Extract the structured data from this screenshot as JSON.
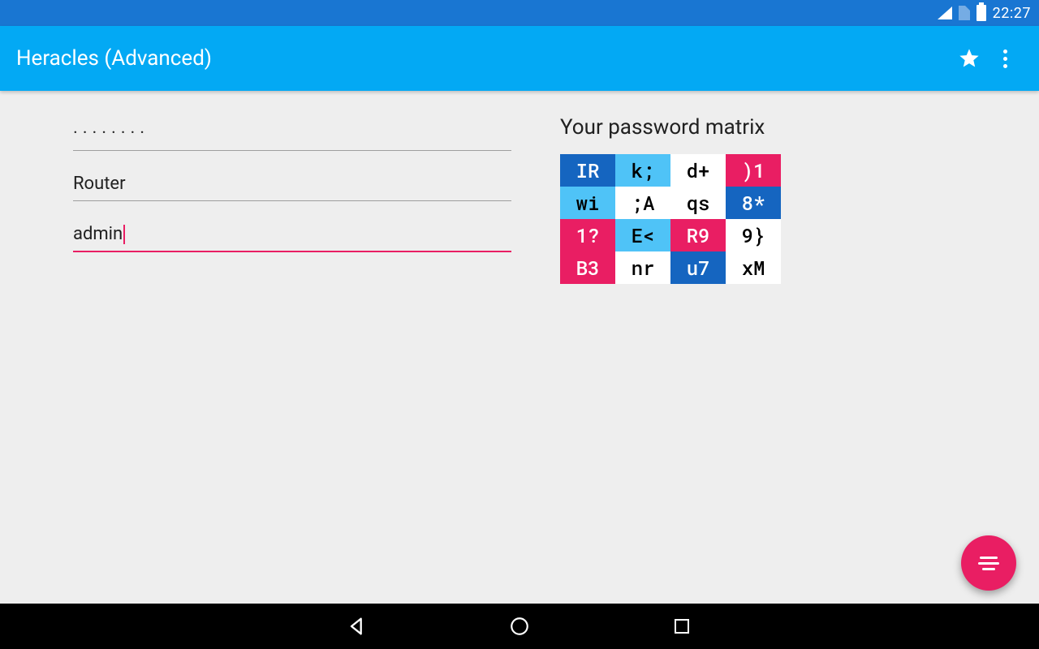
{
  "status": {
    "time": "22:27"
  },
  "appbar": {
    "title": "Heracles (Advanced)"
  },
  "form": {
    "password_mask": "········",
    "service": "Router",
    "username": "admin"
  },
  "matrix": {
    "title": "Your password matrix",
    "cells": [
      [
        {
          "v": "IR",
          "c": "darkblue"
        },
        {
          "v": "k;",
          "c": "lightblue"
        },
        {
          "v": "d+",
          "c": "white"
        },
        {
          "v": ")1",
          "c": "pink"
        }
      ],
      [
        {
          "v": "wi",
          "c": "lightblue"
        },
        {
          "v": ";A",
          "c": "white"
        },
        {
          "v": "qs",
          "c": "white"
        },
        {
          "v": "8*",
          "c": "darkblue"
        }
      ],
      [
        {
          "v": "1?",
          "c": "pink"
        },
        {
          "v": "E<",
          "c": "lightblue"
        },
        {
          "v": "R9",
          "c": "pink"
        },
        {
          "v": "9}",
          "c": "white"
        }
      ],
      [
        {
          "v": "B3",
          "c": "pink"
        },
        {
          "v": "nr",
          "c": "white"
        },
        {
          "v": "u7",
          "c": "darkblue"
        },
        {
          "v": "xM",
          "c": "white"
        }
      ]
    ]
  }
}
